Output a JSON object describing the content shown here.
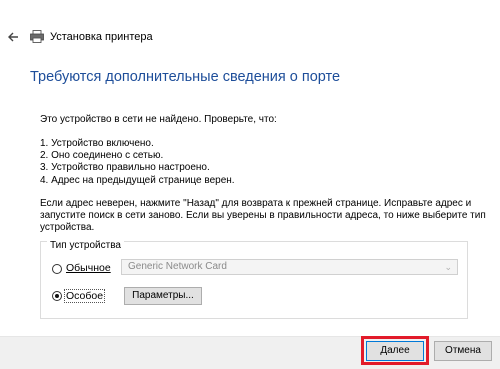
{
  "window": {
    "title": "Установка принтера"
  },
  "page": {
    "heading": "Требуются дополнительные сведения о порте",
    "intro": "Это устройство в сети не найдено. Проверьте, что:",
    "checklist": [
      "1.  Устройство включено.",
      "2.  Оно соединено с сетью.",
      "3.  Устройство правильно настроено.",
      "4.  Адрес на предыдущей странице верен."
    ],
    "paragraph_line1": "Если адрес неверен, нажмите \"Назад\" для возврата к прежней странице.  Исправьте адрес и",
    "paragraph_line2": "запустите поиск в сети заново.  Если вы уверены в правильности адреса, то ниже выберите тип",
    "paragraph_line3": "устройства."
  },
  "device_type": {
    "legend": "Тип устройства",
    "standard_label": "Обычное",
    "standard_selected": false,
    "standard_value": "Generic Network Card",
    "custom_label": "Особое",
    "custom_selected": true,
    "settings_button": "Параметры..."
  },
  "footer": {
    "next_button": "Далее",
    "cancel_button": "Отмена"
  },
  "colors": {
    "heading": "#1e4e9a",
    "highlight": "#e21b2a",
    "primary_border": "#0078d7"
  }
}
